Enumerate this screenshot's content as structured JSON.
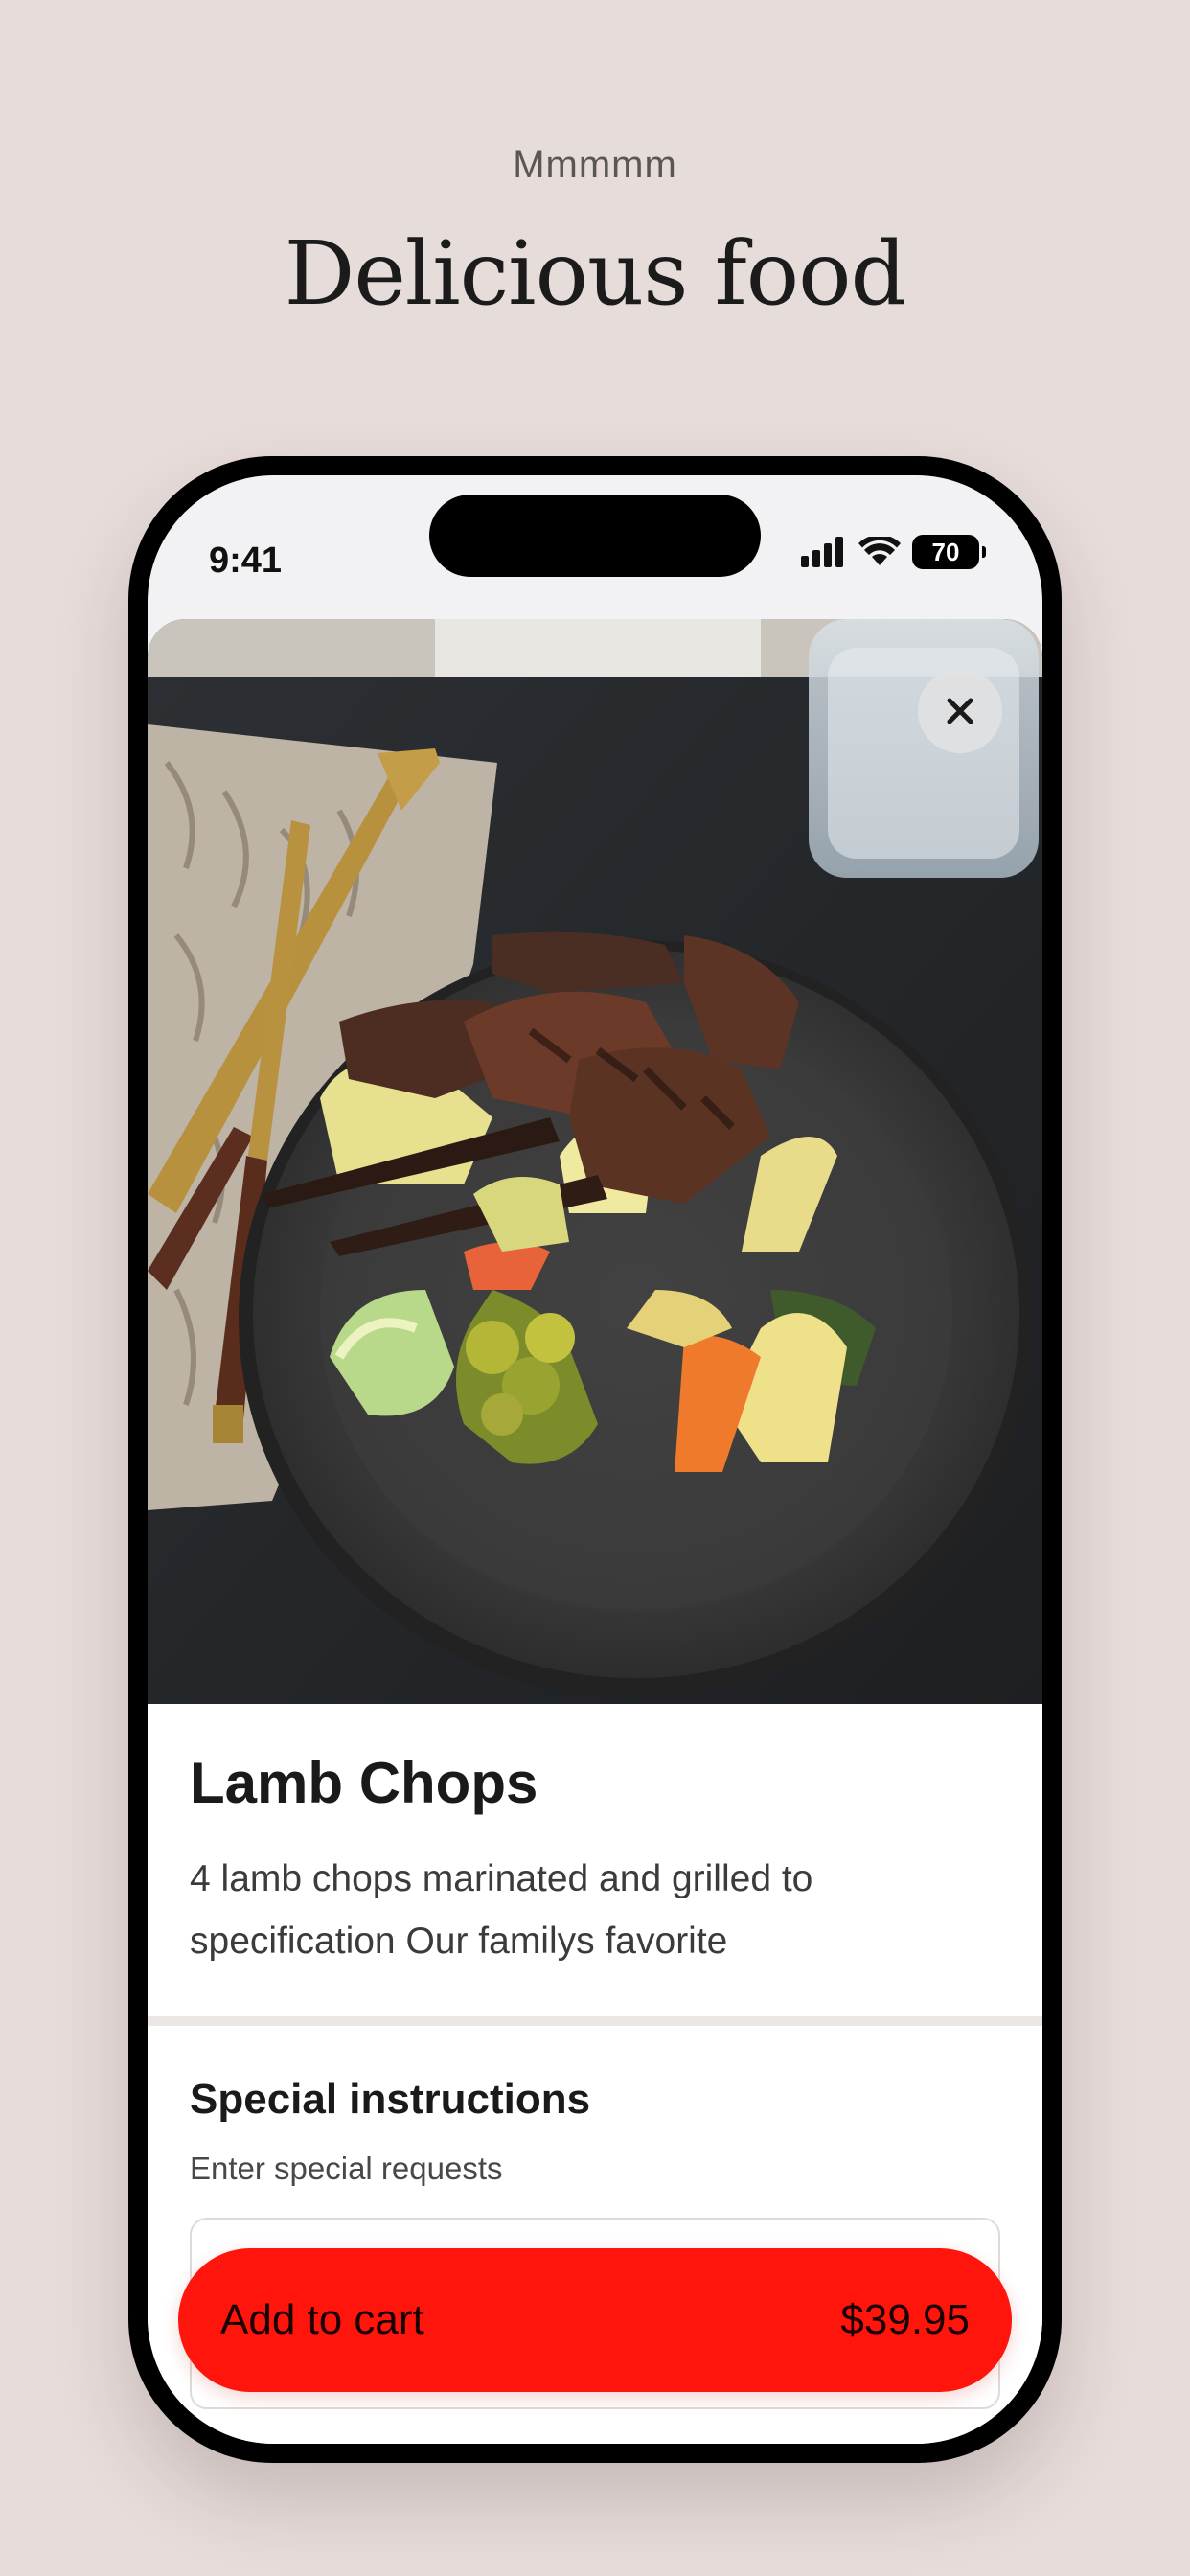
{
  "header": {
    "eyebrow": "Mmmmm",
    "headline": "Delicious food"
  },
  "status_bar": {
    "time": "9:41",
    "battery": "70",
    "icons": [
      "cellular-signal-icon",
      "wifi-icon",
      "battery-icon"
    ]
  },
  "item": {
    "image_alt": "Grilled lamb chops with vegetables on a dark plate",
    "title": "Lamb Chops",
    "description": "4 lamb chops marinated and grilled to specification Our familys favorite"
  },
  "special_instructions": {
    "title": "Special instructions",
    "subtitle": "Enter special requests",
    "placeholder": ""
  },
  "cart_button": {
    "label": "Add to cart",
    "price": "$39.95"
  },
  "colors": {
    "background": "#e6dcda",
    "accent": "#ff150c",
    "divider": "#ece6e4"
  }
}
